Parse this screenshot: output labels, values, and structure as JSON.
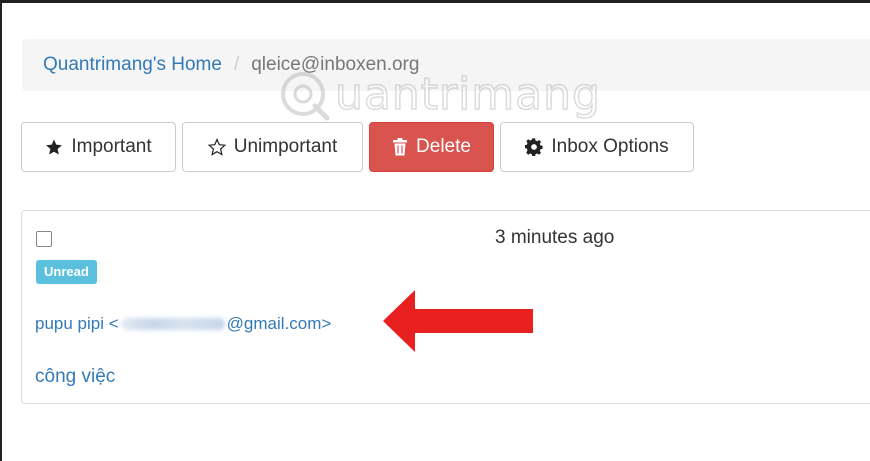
{
  "breadcrumb": {
    "home": "Quantrimang's Home",
    "separator": "/",
    "current": "qleice@inboxen.org"
  },
  "watermark": {
    "text": "uantrimang"
  },
  "toolbar": {
    "important": {
      "label": "Important",
      "icon": "star-solid-icon"
    },
    "unimportant": {
      "label": "Unimportant",
      "icon": "star-outline-icon"
    },
    "delete": {
      "label": "Delete",
      "icon": "trash-icon",
      "color": "#d9534f"
    },
    "inbox_options": {
      "label": "Inbox Options",
      "icon": "gear-icon"
    }
  },
  "message": {
    "time": "3 minutes ago",
    "badge": "Unread",
    "sender_prefix": "pupu pipi <",
    "sender_suffix": "@gmail.com>",
    "subject": "công việc"
  },
  "colors": {
    "link": "#337ab7",
    "danger": "#d9534f",
    "info": "#5bc0de",
    "arrow": "#e8201f"
  }
}
